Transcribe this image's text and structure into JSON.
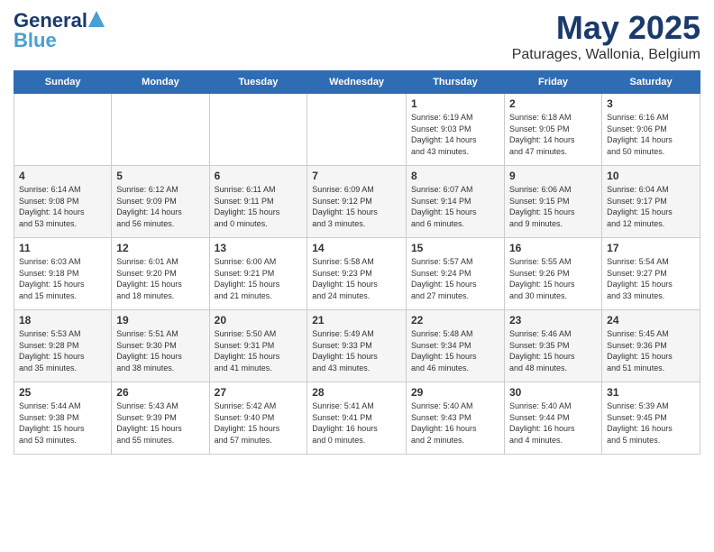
{
  "header": {
    "logo_general": "General",
    "logo_blue": "Blue",
    "title": "May 2025",
    "subtitle": "Paturages, Wallonia, Belgium"
  },
  "weekdays": [
    "Sunday",
    "Monday",
    "Tuesday",
    "Wednesday",
    "Thursday",
    "Friday",
    "Saturday"
  ],
  "weeks": [
    [
      {
        "day": "",
        "info": ""
      },
      {
        "day": "",
        "info": ""
      },
      {
        "day": "",
        "info": ""
      },
      {
        "day": "",
        "info": ""
      },
      {
        "day": "1",
        "info": "Sunrise: 6:19 AM\nSunset: 9:03 PM\nDaylight: 14 hours\nand 43 minutes."
      },
      {
        "day": "2",
        "info": "Sunrise: 6:18 AM\nSunset: 9:05 PM\nDaylight: 14 hours\nand 47 minutes."
      },
      {
        "day": "3",
        "info": "Sunrise: 6:16 AM\nSunset: 9:06 PM\nDaylight: 14 hours\nand 50 minutes."
      }
    ],
    [
      {
        "day": "4",
        "info": "Sunrise: 6:14 AM\nSunset: 9:08 PM\nDaylight: 14 hours\nand 53 minutes."
      },
      {
        "day": "5",
        "info": "Sunrise: 6:12 AM\nSunset: 9:09 PM\nDaylight: 14 hours\nand 56 minutes."
      },
      {
        "day": "6",
        "info": "Sunrise: 6:11 AM\nSunset: 9:11 PM\nDaylight: 15 hours\nand 0 minutes."
      },
      {
        "day": "7",
        "info": "Sunrise: 6:09 AM\nSunset: 9:12 PM\nDaylight: 15 hours\nand 3 minutes."
      },
      {
        "day": "8",
        "info": "Sunrise: 6:07 AM\nSunset: 9:14 PM\nDaylight: 15 hours\nand 6 minutes."
      },
      {
        "day": "9",
        "info": "Sunrise: 6:06 AM\nSunset: 9:15 PM\nDaylight: 15 hours\nand 9 minutes."
      },
      {
        "day": "10",
        "info": "Sunrise: 6:04 AM\nSunset: 9:17 PM\nDaylight: 15 hours\nand 12 minutes."
      }
    ],
    [
      {
        "day": "11",
        "info": "Sunrise: 6:03 AM\nSunset: 9:18 PM\nDaylight: 15 hours\nand 15 minutes."
      },
      {
        "day": "12",
        "info": "Sunrise: 6:01 AM\nSunset: 9:20 PM\nDaylight: 15 hours\nand 18 minutes."
      },
      {
        "day": "13",
        "info": "Sunrise: 6:00 AM\nSunset: 9:21 PM\nDaylight: 15 hours\nand 21 minutes."
      },
      {
        "day": "14",
        "info": "Sunrise: 5:58 AM\nSunset: 9:23 PM\nDaylight: 15 hours\nand 24 minutes."
      },
      {
        "day": "15",
        "info": "Sunrise: 5:57 AM\nSunset: 9:24 PM\nDaylight: 15 hours\nand 27 minutes."
      },
      {
        "day": "16",
        "info": "Sunrise: 5:55 AM\nSunset: 9:26 PM\nDaylight: 15 hours\nand 30 minutes."
      },
      {
        "day": "17",
        "info": "Sunrise: 5:54 AM\nSunset: 9:27 PM\nDaylight: 15 hours\nand 33 minutes."
      }
    ],
    [
      {
        "day": "18",
        "info": "Sunrise: 5:53 AM\nSunset: 9:28 PM\nDaylight: 15 hours\nand 35 minutes."
      },
      {
        "day": "19",
        "info": "Sunrise: 5:51 AM\nSunset: 9:30 PM\nDaylight: 15 hours\nand 38 minutes."
      },
      {
        "day": "20",
        "info": "Sunrise: 5:50 AM\nSunset: 9:31 PM\nDaylight: 15 hours\nand 41 minutes."
      },
      {
        "day": "21",
        "info": "Sunrise: 5:49 AM\nSunset: 9:33 PM\nDaylight: 15 hours\nand 43 minutes."
      },
      {
        "day": "22",
        "info": "Sunrise: 5:48 AM\nSunset: 9:34 PM\nDaylight: 15 hours\nand 46 minutes."
      },
      {
        "day": "23",
        "info": "Sunrise: 5:46 AM\nSunset: 9:35 PM\nDaylight: 15 hours\nand 48 minutes."
      },
      {
        "day": "24",
        "info": "Sunrise: 5:45 AM\nSunset: 9:36 PM\nDaylight: 15 hours\nand 51 minutes."
      }
    ],
    [
      {
        "day": "25",
        "info": "Sunrise: 5:44 AM\nSunset: 9:38 PM\nDaylight: 15 hours\nand 53 minutes."
      },
      {
        "day": "26",
        "info": "Sunrise: 5:43 AM\nSunset: 9:39 PM\nDaylight: 15 hours\nand 55 minutes."
      },
      {
        "day": "27",
        "info": "Sunrise: 5:42 AM\nSunset: 9:40 PM\nDaylight: 15 hours\nand 57 minutes."
      },
      {
        "day": "28",
        "info": "Sunrise: 5:41 AM\nSunset: 9:41 PM\nDaylight: 16 hours\nand 0 minutes."
      },
      {
        "day": "29",
        "info": "Sunrise: 5:40 AM\nSunset: 9:43 PM\nDaylight: 16 hours\nand 2 minutes."
      },
      {
        "day": "30",
        "info": "Sunrise: 5:40 AM\nSunset: 9:44 PM\nDaylight: 16 hours\nand 4 minutes."
      },
      {
        "day": "31",
        "info": "Sunrise: 5:39 AM\nSunset: 9:45 PM\nDaylight: 16 hours\nand 5 minutes."
      }
    ]
  ]
}
